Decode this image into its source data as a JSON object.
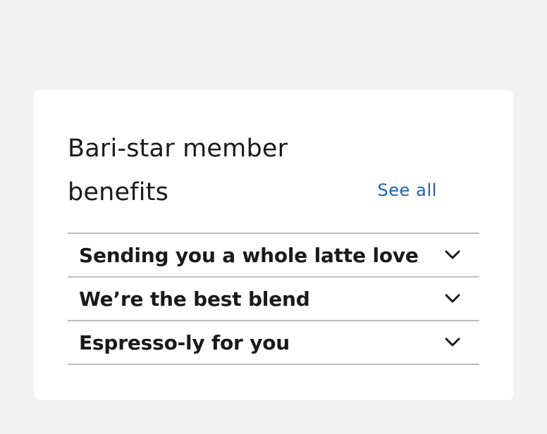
{
  "benefits_card": {
    "title": "Bari-star member benefits",
    "see_all_label": "See all",
    "accordion_items": [
      {
        "label": "Sending you a whole latte love",
        "icon": "chevron-down-icon",
        "expanded": false
      },
      {
        "label": "We’re the best blend",
        "icon": "chevron-down-icon",
        "expanded": false
      },
      {
        "label": "Espresso-ly for you",
        "icon": "chevron-down-icon",
        "expanded": false
      }
    ]
  },
  "colors": {
    "page_background": "#f2f2f2",
    "card_background": "#ffffff",
    "link": "#1f5fb0",
    "text": "#1a1a1a",
    "divider": "#bdbdbd"
  }
}
